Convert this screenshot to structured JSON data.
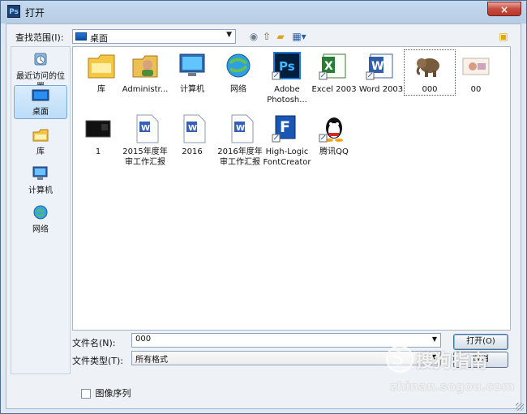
{
  "window": {
    "title": "打开",
    "app_icon_text": "Ps",
    "close_symbol": "×"
  },
  "toolbar": {
    "look_in_label": "查找范围(I):",
    "look_in_value": "桌面"
  },
  "places": [
    {
      "label": "最近访问的位置",
      "icon": "recent-places-icon"
    },
    {
      "label": "桌面",
      "icon": "desktop-icon",
      "selected": true
    },
    {
      "label": "库",
      "icon": "library-icon"
    },
    {
      "label": "计算机",
      "icon": "computer-icon"
    },
    {
      "label": "网络",
      "icon": "network-icon"
    }
  ],
  "files": [
    {
      "label": "库"
    },
    {
      "label": "Administr..."
    },
    {
      "label": "计算机"
    },
    {
      "label": "网络"
    },
    {
      "label": "Adobe Photosh..."
    },
    {
      "label": "Excel 2003"
    },
    {
      "label": "Word 2003"
    },
    {
      "label": "000",
      "selected": true
    },
    {
      "label": "00"
    },
    {
      "label": "1"
    },
    {
      "label": "2015年度年审工作汇报"
    },
    {
      "label": "2016"
    },
    {
      "label": "2016年度年审工作汇报"
    },
    {
      "label": "High-Logic FontCreator"
    },
    {
      "label": "腾讯QQ"
    }
  ],
  "file_name": {
    "label": "文件名(N):",
    "value": "000"
  },
  "file_type": {
    "label": "文件类型(T):",
    "value": "所有格式"
  },
  "buttons": {
    "open": "打开(O)",
    "cancel": "取消"
  },
  "image_sequence": "图像序列",
  "watermark": {
    "brand": "搜狗指南",
    "url": "zhinan.sogou.com"
  }
}
